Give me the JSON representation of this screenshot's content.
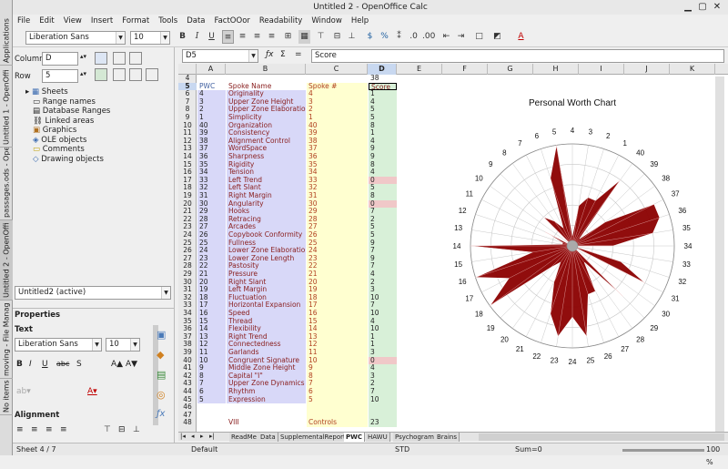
{
  "title": "Untitled 2 - OpenOffice Calc",
  "left_tabs": [
    "Applications",
    "Untitled 1 - OpenOffi",
    "passages.ods - Open",
    "Untitled 2 - OpenOffi",
    "moving - File Manag",
    "No items"
  ],
  "menu": [
    "File",
    "Edit",
    "View",
    "Insert",
    "Format",
    "Tools",
    "Data",
    "FactOOor",
    "Readability",
    "Window",
    "Help"
  ],
  "toolbar": {
    "font": "Liberation Sans",
    "size": "10"
  },
  "formula": {
    "cell": "D5",
    "content": "Score"
  },
  "navigator": {
    "column_label": "Column",
    "column_value": "D",
    "row_label": "Row",
    "row_value": "5",
    "items": [
      "Sheets",
      "Range names",
      "Database Ranges",
      "Linked areas",
      "Graphics",
      "OLE objects",
      "Comments",
      "Drawing objects"
    ],
    "doc_select": "Untitled2 (active)"
  },
  "properties": {
    "header": "Properties",
    "text_section": "Text",
    "font": "Liberation Sans",
    "size": "10",
    "alignment_section": "Alignment"
  },
  "columns": [
    "A",
    "B",
    "C",
    "D",
    "E",
    "F",
    "G",
    "H",
    "I",
    "J",
    "K"
  ],
  "rows": [
    {
      "n": "4",
      "a": "",
      "b": "",
      "c": "",
      "d": "38"
    },
    {
      "n": "5",
      "a": "PWC",
      "b": "Spoke Name",
      "c": "Spoke #",
      "d": "Score"
    },
    {
      "n": "6",
      "a": "4",
      "b": "Originality",
      "c": "4",
      "d": "1"
    },
    {
      "n": "7",
      "a": "3",
      "b": "Upper Zone Height",
      "c": "3",
      "d": "4"
    },
    {
      "n": "8",
      "a": "2",
      "b": "Upper Zone Elaboration",
      "c": "2",
      "d": "5"
    },
    {
      "n": "9",
      "a": "1",
      "b": "Simplicity",
      "c": "1",
      "d": "5"
    },
    {
      "n": "10",
      "a": "40",
      "b": "Organization",
      "c": "40",
      "d": "8"
    },
    {
      "n": "11",
      "a": "39",
      "b": "Consistency",
      "c": "39",
      "d": "1"
    },
    {
      "n": "12",
      "a": "38",
      "b": "Alignment Control",
      "c": "38",
      "d": "4"
    },
    {
      "n": "13",
      "a": "37",
      "b": "WordSpace",
      "c": "37",
      "d": "9"
    },
    {
      "n": "14",
      "a": "36",
      "b": "Sharpness",
      "c": "36",
      "d": "9"
    },
    {
      "n": "15",
      "a": "35",
      "b": "Rigidity",
      "c": "35",
      "d": "8"
    },
    {
      "n": "16",
      "a": "34",
      "b": "Tension",
      "c": "34",
      "d": "4"
    },
    {
      "n": "17",
      "a": "33",
      "b": "Left Trend",
      "c": "33",
      "d": "0"
    },
    {
      "n": "18",
      "a": "32",
      "b": "Left Slant",
      "c": "32",
      "d": "5"
    },
    {
      "n": "19",
      "a": "31",
      "b": "Right Margin",
      "c": "31",
      "d": "8"
    },
    {
      "n": "20",
      "a": "30",
      "b": "Angularity",
      "c": "30",
      "d": "0"
    },
    {
      "n": "21",
      "a": "29",
      "b": "Hooks",
      "c": "29",
      "d": "7"
    },
    {
      "n": "22",
      "a": "28",
      "b": "Retracing",
      "c": "28",
      "d": "2"
    },
    {
      "n": "23",
      "a": "27",
      "b": "Arcades",
      "c": "27",
      "d": "5"
    },
    {
      "n": "24",
      "a": "26",
      "b": "Copybook Conformity",
      "c": "26",
      "d": "5"
    },
    {
      "n": "25",
      "a": "25",
      "b": "Fullness",
      "c": "25",
      "d": "9"
    },
    {
      "n": "26",
      "a": "24",
      "b": "Lower Zone Elaboration",
      "c": "24",
      "d": "7"
    },
    {
      "n": "27",
      "a": "23",
      "b": "Lower Zone Length",
      "c": "23",
      "d": "9"
    },
    {
      "n": "28",
      "a": "22",
      "b": "Pastosity",
      "c": "22",
      "d": "7"
    },
    {
      "n": "29",
      "a": "21",
      "b": "Pressure",
      "c": "21",
      "d": "4"
    },
    {
      "n": "30",
      "a": "20",
      "b": "Right Slant",
      "c": "20",
      "d": "2"
    },
    {
      "n": "31",
      "a": "19",
      "b": "Left Margin",
      "c": "19",
      "d": "3"
    },
    {
      "n": "32",
      "a": "18",
      "b": "Fluctuation",
      "c": "18",
      "d": "10"
    },
    {
      "n": "33",
      "a": "17",
      "b": "Horizontal Expansion",
      "c": "17",
      "d": "7"
    },
    {
      "n": "34",
      "a": "16",
      "b": "Speed",
      "c": "16",
      "d": "10"
    },
    {
      "n": "35",
      "a": "15",
      "b": "Thread",
      "c": "15",
      "d": "4"
    },
    {
      "n": "36",
      "a": "14",
      "b": "Flexibility",
      "c": "14",
      "d": "10"
    },
    {
      "n": "37",
      "a": "13",
      "b": "Right Trend",
      "c": "13",
      "d": "1"
    },
    {
      "n": "38",
      "a": "12",
      "b": "Connectedness",
      "c": "12",
      "d": "1"
    },
    {
      "n": "39",
      "a": "11",
      "b": "Garlands",
      "c": "11",
      "d": "3"
    },
    {
      "n": "40",
      "a": "10",
      "b": "Congruent Signature",
      "c": "10",
      "d": "0"
    },
    {
      "n": "41",
      "a": "9",
      "b": "Middle Zone Height",
      "c": "9",
      "d": "4"
    },
    {
      "n": "42",
      "a": "8",
      "b": "Capital \"I\"",
      "c": "8",
      "d": "3"
    },
    {
      "n": "43",
      "a": "7",
      "b": "Upper Zone Dynamics",
      "c": "7",
      "d": "2"
    },
    {
      "n": "44",
      "a": "6",
      "b": "Rhythm",
      "c": "6",
      "d": "7"
    },
    {
      "n": "45",
      "a": "5",
      "b": "Expression",
      "c": "5",
      "d": "10"
    },
    {
      "n": "46",
      "a": "",
      "b": "",
      "c": "",
      "d": ""
    },
    {
      "n": "47",
      "a": "",
      "b": "",
      "c": "",
      "d": ""
    },
    {
      "n": "48",
      "a": "",
      "b": "VIII",
      "c": "Controls",
      "d": "23"
    }
  ],
  "sheet_tabs": [
    "ReadMe",
    "Data",
    "SupplementalReport",
    "PWC",
    "HAWU",
    "Psychogram",
    "Brains"
  ],
  "status": {
    "sheet": "Sheet 4 / 7",
    "style": "Default",
    "mode": "STD",
    "sum": "Sum=0",
    "zoom": "100 %"
  },
  "chart_data": {
    "type": "radar",
    "title": "Personal Worth Chart",
    "axis_labels": [
      "4",
      "3",
      "2",
      "1",
      "40",
      "39",
      "38",
      "37",
      "36",
      "35",
      "34",
      "33",
      "32",
      "31",
      "30",
      "29",
      "28",
      "27",
      "26",
      "25",
      "24",
      "23",
      "22",
      "21",
      "20",
      "19",
      "18",
      "17",
      "16",
      "15",
      "14",
      "13",
      "12",
      "11",
      "10",
      "9",
      "8",
      "7",
      "6",
      "5"
    ],
    "values": [
      1,
      4,
      5,
      5,
      8,
      1,
      4,
      9,
      9,
      8,
      4,
      0,
      5,
      8,
      0,
      7,
      2,
      5,
      5,
      9,
      7,
      9,
      7,
      4,
      2,
      3,
      10,
      7,
      10,
      4,
      10,
      1,
      1,
      3,
      0,
      4,
      3,
      2,
      7,
      10
    ],
    "rlim": [
      0,
      10
    ],
    "fill": "#8b0000"
  }
}
